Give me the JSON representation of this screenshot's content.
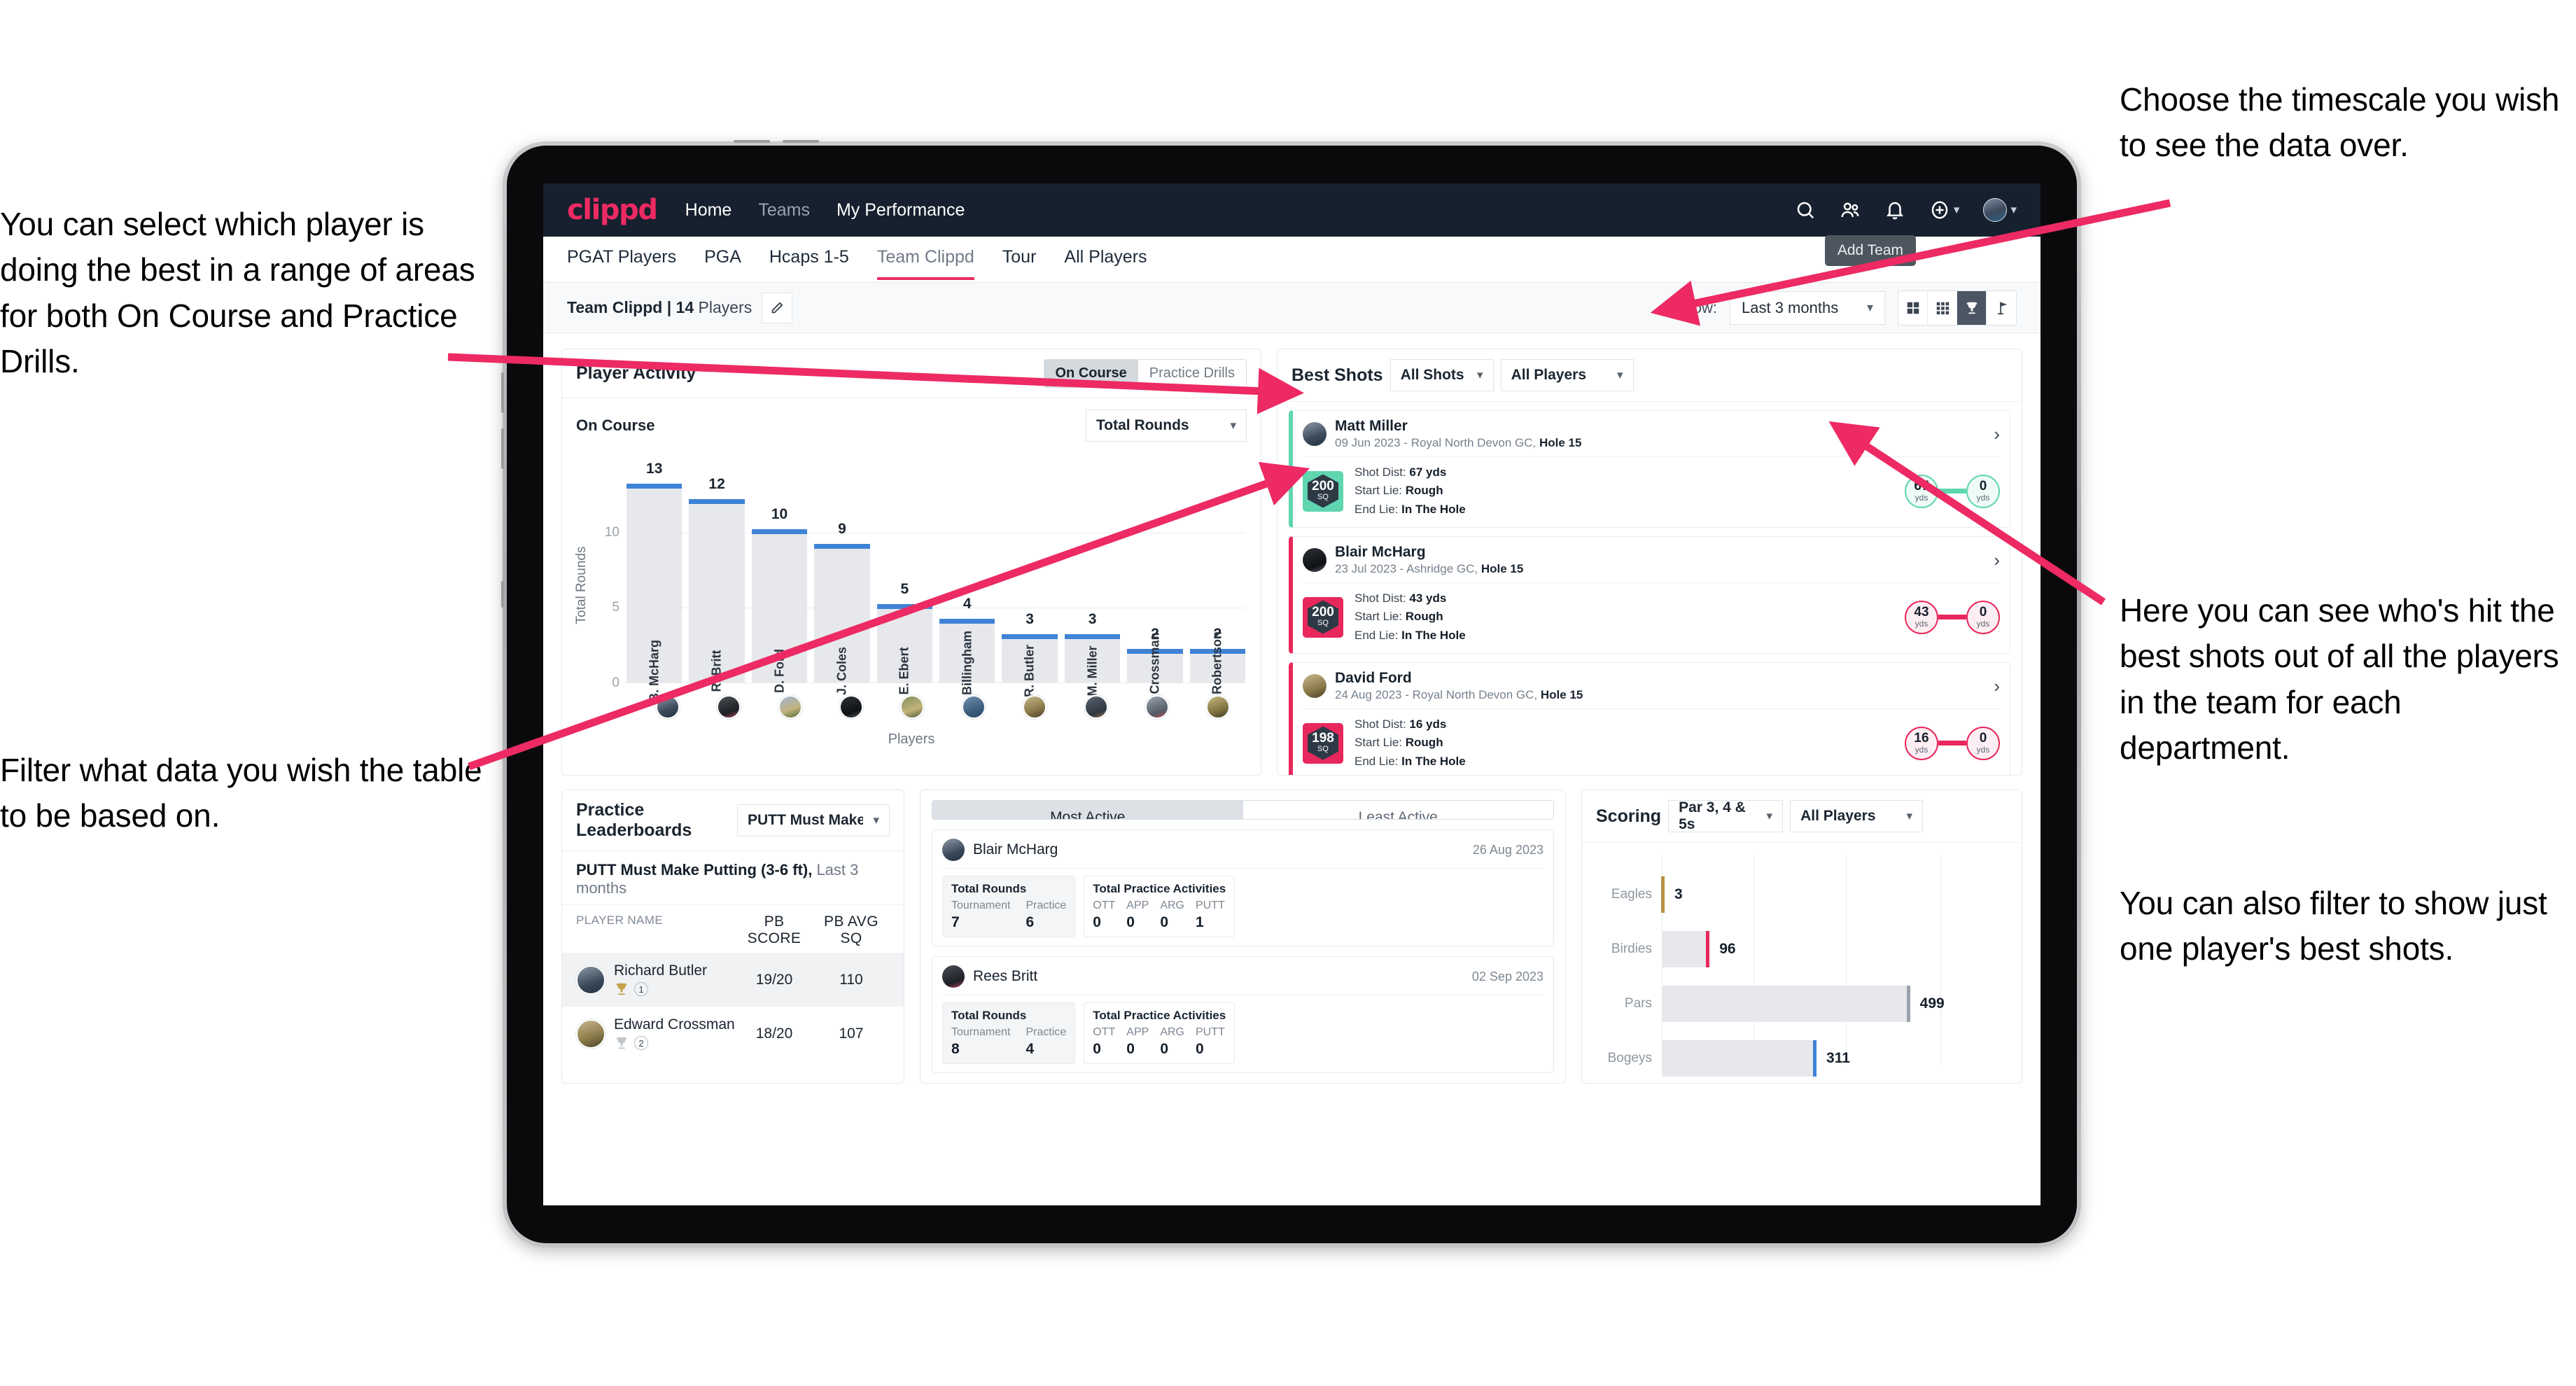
{
  "annotations": {
    "left_top": "You can select which player is doing the best in a range of areas for both On Course and Practice Drills.",
    "left_bottom": "Filter what data you wish the table to be based on.",
    "right_top": "Choose the timescale you wish to see the data over.",
    "right_middle": "Here you can see who's hit the best shots out of all the players in the team for each department.",
    "right_bottom": "You can also filter to show just one player's best shots."
  },
  "app": {
    "logo": "clippd",
    "nav_links": [
      {
        "label": "Home",
        "active": true
      },
      {
        "label": "Teams",
        "active": false
      },
      {
        "label": "My Performance",
        "active": true
      }
    ],
    "nav_icons": [
      "search-icon",
      "people-icon",
      "bell-icon",
      "plus-circle-icon",
      "avatar"
    ],
    "tooltip": "Add Team",
    "tabs": [
      {
        "label": "PGAT Players",
        "active": false
      },
      {
        "label": "PGA",
        "active": false
      },
      {
        "label": "Hcaps 1-5",
        "active": false
      },
      {
        "label": "Team Clippd",
        "active": true
      },
      {
        "label": "Tour",
        "active": false
      },
      {
        "label": "All Players",
        "active": false
      }
    ],
    "subheader": {
      "team_name": "Team Clippd",
      "separator": " | ",
      "player_count": "14",
      "players_word": " Players",
      "edit_icon": "pencil-icon",
      "show_label": "Show:",
      "timescale_value": "Last 3 months",
      "view_icons": [
        {
          "name": "grid-2x2-icon",
          "active": false
        },
        {
          "name": "grid-3x3-icon",
          "active": false
        },
        {
          "name": "trophy-icon",
          "active": true
        },
        {
          "name": "flag-icon",
          "active": false
        }
      ]
    }
  },
  "player_activity": {
    "title": "Player Activity",
    "segments": [
      {
        "label": "On Course",
        "active": true
      },
      {
        "label": "Practice Drills",
        "active": false
      }
    ],
    "sub_label": "On Course",
    "metric_select": "Total Rounds"
  },
  "best_shots": {
    "title": "Best Shots",
    "filter_shots": "All Shots",
    "filter_players": "All Players",
    "cards": [
      {
        "player": "Matt Miller",
        "meta_date": "09 Jun 2023 - Royal North Devon GC, ",
        "meta_hole": "Hole 15",
        "badge_value": "200",
        "badge_unit": "SQ",
        "accent": "#5fd6b0",
        "shot_dist_label": "Shot Dist: ",
        "shot_dist": "67 yds",
        "start_lie_label": "Start Lie: ",
        "start_lie": "Rough",
        "end_lie_label": "End Lie: ",
        "end_lie": "In The Hole",
        "from_value": "67",
        "from_unit": "yds",
        "to_value": "0",
        "to_unit": "yds"
      },
      {
        "player": "Blair McHarg",
        "meta_date": "23 Jul 2023 - Ashridge GC, ",
        "meta_hole": "Hole 15",
        "badge_value": "200",
        "badge_unit": "SQ",
        "accent": "#e8275c",
        "shot_dist_label": "Shot Dist: ",
        "shot_dist": "43 yds",
        "start_lie_label": "Start Lie: ",
        "start_lie": "Rough",
        "end_lie_label": "End Lie: ",
        "end_lie": "In The Hole",
        "from_value": "43",
        "from_unit": "yds",
        "to_value": "0",
        "to_unit": "yds"
      },
      {
        "player": "David Ford",
        "meta_date": "24 Aug 2023 - Royal North Devon GC, ",
        "meta_hole": "Hole 15",
        "badge_value": "198",
        "badge_unit": "SQ",
        "accent": "#e8275c",
        "shot_dist_label": "Shot Dist: ",
        "shot_dist": "16 yds",
        "start_lie_label": "Start Lie: ",
        "start_lie": "Rough",
        "end_lie_label": "End Lie: ",
        "end_lie": "In The Hole",
        "from_value": "16",
        "from_unit": "yds",
        "to_value": "0",
        "to_unit": "yds"
      }
    ]
  },
  "practice_leaderboards": {
    "title": "Practice Leaderboards",
    "drill_select": "PUTT Must Make Putting ...",
    "subtitle_bold": "PUTT Must Make Putting (3-6 ft),",
    "subtitle_light": " Last 3 months",
    "columns": [
      "PLAYER NAME",
      "PB SCORE",
      "PB AVG SQ"
    ],
    "rows": [
      {
        "name": "Richard Butler",
        "rank": "1",
        "trophy": "gold",
        "pb_score": "19/20",
        "pb_avg_sq": "110",
        "highlight": true
      },
      {
        "name": "Edward Crossman",
        "rank": "2",
        "trophy": "silver",
        "pb_score": "18/20",
        "pb_avg_sq": "107",
        "highlight": false
      }
    ]
  },
  "activity": {
    "tabs": [
      {
        "label": "Most Active",
        "active": true
      },
      {
        "label": "Least Active",
        "active": false
      }
    ],
    "rounds_title": "Total Rounds",
    "rounds_cols": [
      "Tournament",
      "Practice"
    ],
    "practice_title": "Total Practice Activities",
    "practice_cols": [
      "OTT",
      "APP",
      "ARG",
      "PUTT"
    ],
    "cards": [
      {
        "player": "Blair McHarg",
        "date": "26 Aug 2023",
        "tournament": "7",
        "practice": "6",
        "ott": "0",
        "app": "0",
        "arg": "0",
        "putt": "1"
      },
      {
        "player": "Rees Britt",
        "date": "02 Sep 2023",
        "tournament": "8",
        "practice": "4",
        "ott": "0",
        "app": "0",
        "arg": "0",
        "putt": "0"
      }
    ]
  },
  "scoring": {
    "title": "Scoring",
    "filter_par": "Par 3, 4 & 5s",
    "filter_players": "All Players"
  },
  "chart_data": [
    {
      "type": "bar",
      "title": "Player Activity - On Course",
      "xlabel": "Players",
      "ylabel": "Total Rounds",
      "ylim": [
        0,
        14
      ],
      "yticks": [
        0,
        5,
        10
      ],
      "grid": true,
      "categories": [
        "B. McHarg",
        "R. Britt",
        "D. Ford",
        "J. Coles",
        "E. Ebert",
        "D. Billingham",
        "R. Butler",
        "M. Miller",
        "E. Crossman",
        "C. Robertson"
      ],
      "values": [
        13,
        12,
        10,
        9,
        5,
        4,
        3,
        3,
        2,
        2
      ],
      "bar_color": "#e6e8ec",
      "cap_color": "#3f83d6"
    },
    {
      "type": "bar",
      "orientation": "horizontal",
      "title": "Scoring",
      "xlabel": "",
      "ylabel": "",
      "categories": [
        "Eagles",
        "Birdies",
        "Pars",
        "Bogeys"
      ],
      "values": [
        3,
        96,
        499,
        311
      ],
      "xlim": [
        0,
        560
      ],
      "cap_colors": [
        "#b89143",
        "#e8275c",
        "#9aa2ab",
        "#3f83d6"
      ],
      "bar_color": "#e6e8ec",
      "grid": true
    }
  ]
}
